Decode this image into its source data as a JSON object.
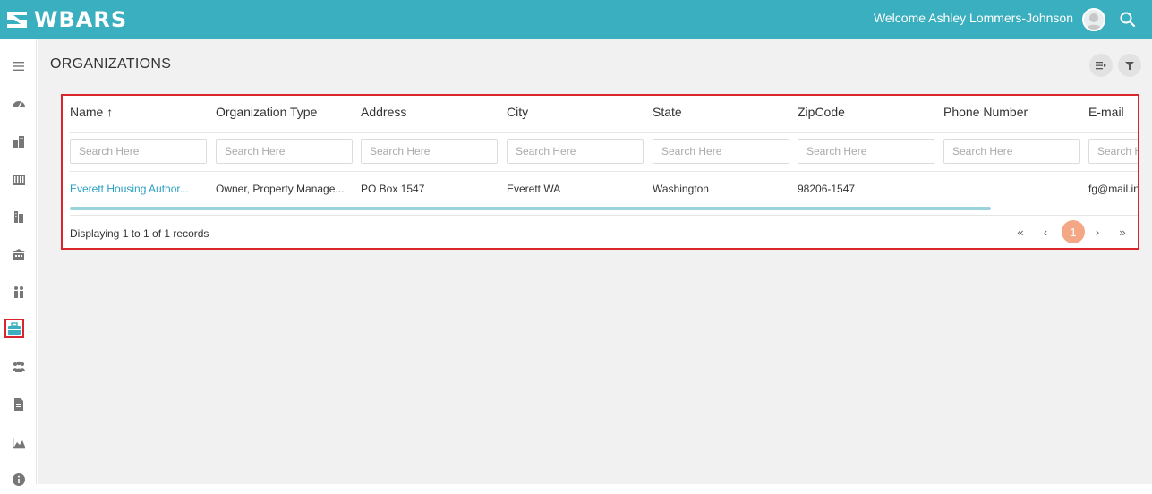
{
  "app": {
    "logo_text": "WBARS",
    "welcome_text": "Welcome Ashley Lommers-Johnson",
    "accent": "#3aafbf"
  },
  "sidebar": {
    "items": [
      {
        "icon": "menu-icon"
      },
      {
        "icon": "dashboard-icon"
      },
      {
        "icon": "buildings-icon"
      },
      {
        "icon": "property-icon"
      },
      {
        "icon": "units-icon"
      },
      {
        "icon": "housing-icon"
      },
      {
        "icon": "people-icon"
      },
      {
        "icon": "briefcase-icon",
        "active": true
      },
      {
        "icon": "users-icon"
      },
      {
        "icon": "document-icon"
      },
      {
        "icon": "chart-icon"
      },
      {
        "icon": "info-icon"
      }
    ]
  },
  "page": {
    "title": "ORGANIZATIONS",
    "buttons": [
      {
        "icon": "column-settings-icon"
      },
      {
        "icon": "filter-icon"
      }
    ]
  },
  "table": {
    "columns": [
      "Name",
      "Organization Type",
      "Address",
      "City",
      "State",
      "ZipCode",
      "Phone Number",
      "E-mail"
    ],
    "sort_indicator": "↑",
    "filter_placeholder": "Search Here",
    "rows": [
      [
        "Everett Housing Author...",
        "Owner, Property Manage...",
        "PO Box 1547",
        "Everett WA",
        "Washington",
        "98206-1547",
        "",
        "fg@mail.in"
      ]
    ],
    "footer": "Displaying 1 to 1 of 1 records",
    "pager": {
      "first": "«",
      "prev": "‹",
      "current": "1",
      "next": "›",
      "last": "»"
    }
  }
}
